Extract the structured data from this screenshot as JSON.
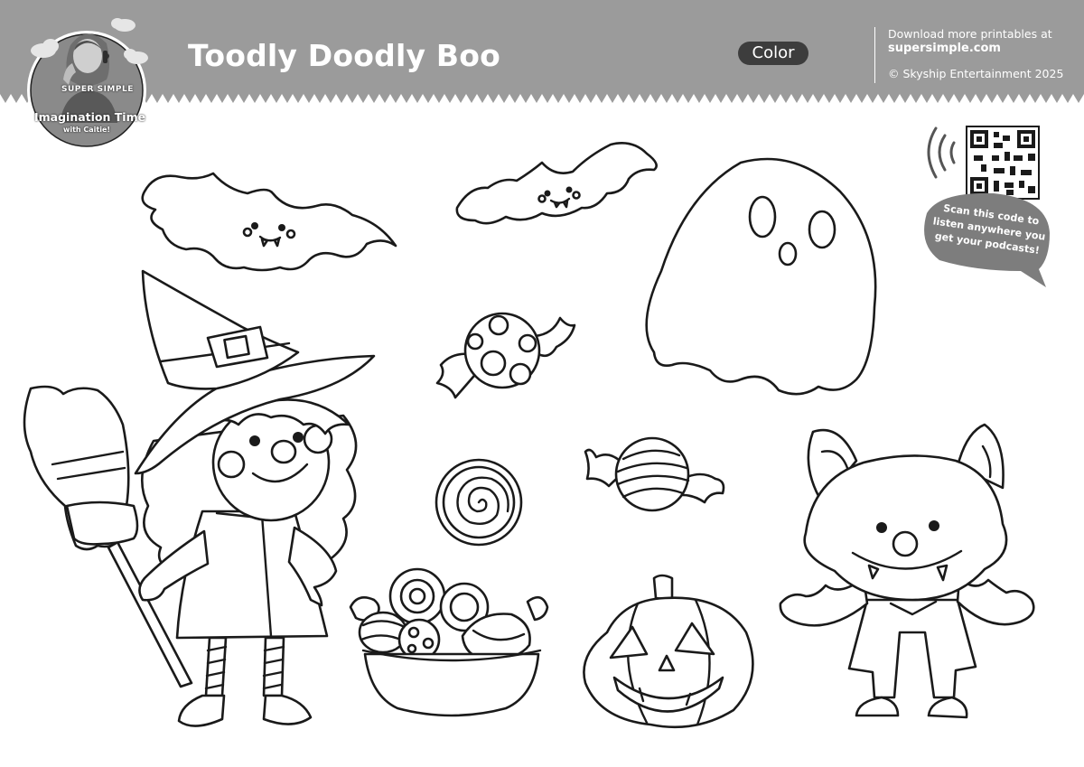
{
  "header": {
    "title": "Toodly Doodly Boo",
    "mode_badge": "Color",
    "download_line": "Download more printables at",
    "download_site": "supersimple.com",
    "copyright": "© Skyship Entertainment 2025",
    "background_color": "#9b9b9b"
  },
  "logo": {
    "brand": "SUPER SIMPLE",
    "show_name": "Imagination Time",
    "host_line": "with Caitie!"
  },
  "qr": {
    "caption_line1": "Scan this code to",
    "caption_line2": "listen anywhere you",
    "caption_line3": "get your podcasts!"
  },
  "illustrations": [
    {
      "name": "bat",
      "icon": "bat-icon"
    },
    {
      "name": "bat",
      "icon": "bat-icon"
    },
    {
      "name": "ghost",
      "icon": "ghost-icon"
    },
    {
      "name": "witch",
      "icon": "witch-icon"
    },
    {
      "name": "wrapped candy",
      "icon": "candy-icon"
    },
    {
      "name": "lollipop swirl",
      "icon": "swirl-candy-icon"
    },
    {
      "name": "striped candy",
      "icon": "candy-icon"
    },
    {
      "name": "candy bowl",
      "icon": "candy-bowl-icon"
    },
    {
      "name": "jack-o-lantern",
      "icon": "pumpkin-icon"
    },
    {
      "name": "wolf costume",
      "icon": "wolf-icon"
    }
  ]
}
